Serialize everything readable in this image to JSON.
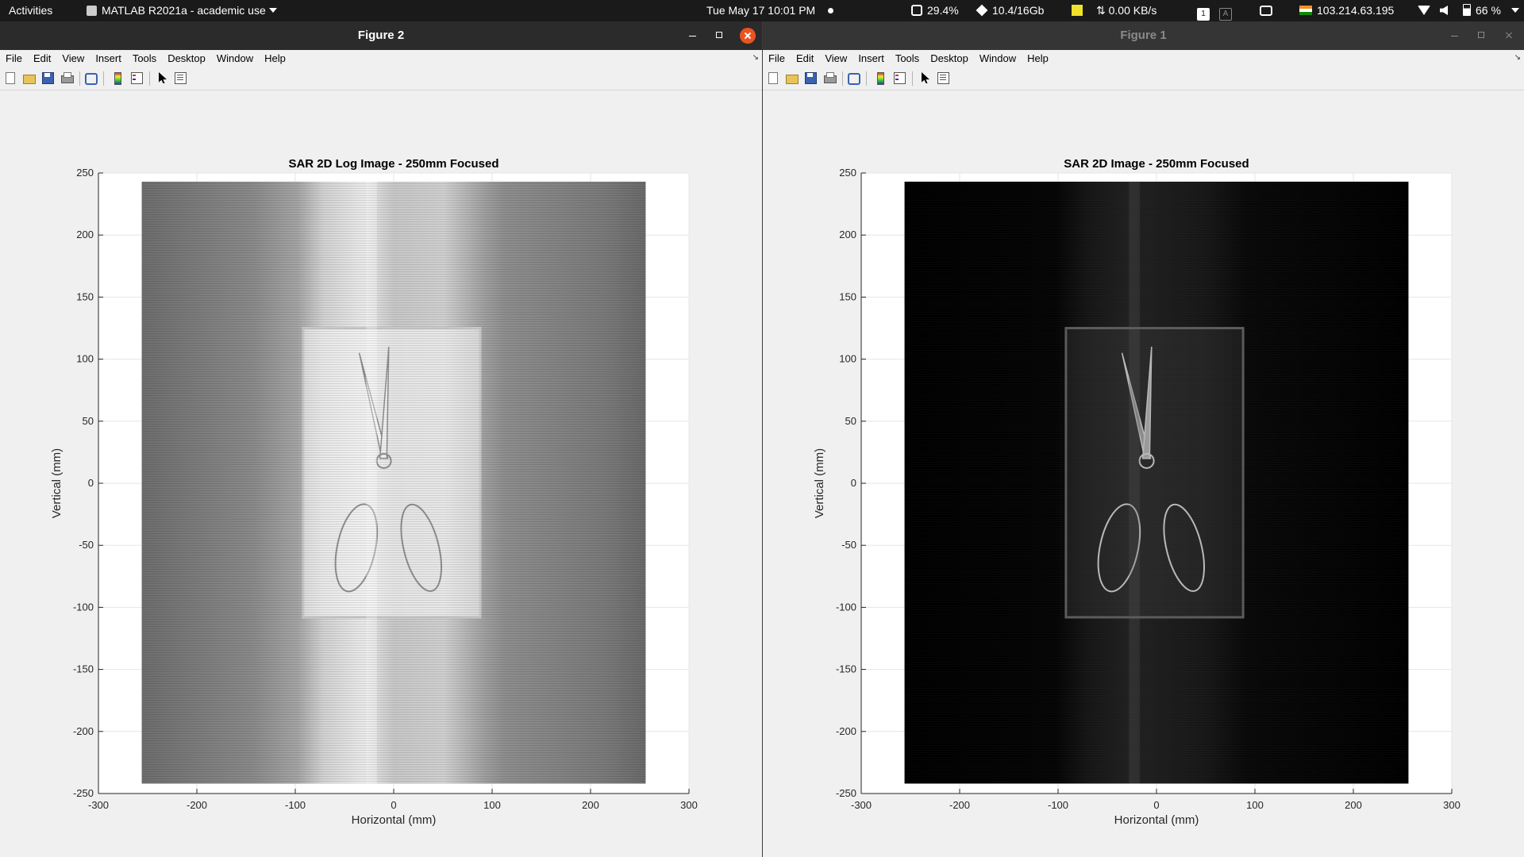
{
  "topbar": {
    "activities": "Activities",
    "app_menu": "MATLAB R2021a - academic use",
    "clock": "Tue May 17  10:01 PM",
    "cpu": "29.4%",
    "memory": "10.4/16Gb",
    "network": "⇅ 0.00 KB/s",
    "workspace_1": "1",
    "workspace_2": "A",
    "ip": "103.214.63.195",
    "battery": "66 %"
  },
  "menus": [
    "File",
    "Edit",
    "View",
    "Insert",
    "Tools",
    "Desktop",
    "Window",
    "Help"
  ],
  "toolbar_icons": [
    "new-figure-icon",
    "open-file-icon",
    "save-icon",
    "print-icon",
    "link-plot-icon",
    "colorbar-icon",
    "legend-icon",
    "pointer-icon",
    "property-inspector-icon"
  ],
  "windows": [
    {
      "title": "Figure 2",
      "active": true,
      "chart_data": {
        "type": "heatmap",
        "title": "SAR 2D Log Image - 250mm Focused",
        "xlabel": "Horizontal (mm)",
        "ylabel": "Vertical (mm)",
        "xlim": [
          -300,
          300
        ],
        "ylim": [
          -250,
          250
        ],
        "xticks": [
          -300,
          -200,
          -100,
          0,
          100,
          200,
          300
        ],
        "yticks": [
          250,
          200,
          150,
          100,
          50,
          0,
          -50,
          -100,
          -150,
          -200,
          -250
        ],
        "image_extent": {
          "x": [
            -256,
            256
          ],
          "y": [
            -242,
            243
          ]
        },
        "colormap": "gray",
        "scale": "log",
        "grid": true
      }
    },
    {
      "title": "Figure 1",
      "active": false,
      "chart_data": {
        "type": "heatmap",
        "title": "SAR 2D Image - 250mm Focused",
        "xlabel": "Horizontal (mm)",
        "ylabel": "Vertical (mm)",
        "xlim": [
          -300,
          300
        ],
        "ylim": [
          -250,
          250
        ],
        "xticks": [
          -300,
          -200,
          -100,
          0,
          100,
          200,
          300
        ],
        "yticks": [
          250,
          200,
          150,
          100,
          50,
          0,
          -50,
          -100,
          -150,
          -200,
          -250
        ],
        "image_extent": {
          "x": [
            -256,
            256
          ],
          "y": [
            -242,
            243
          ]
        },
        "colormap": "gray",
        "scale": "linear",
        "grid": true
      }
    }
  ]
}
